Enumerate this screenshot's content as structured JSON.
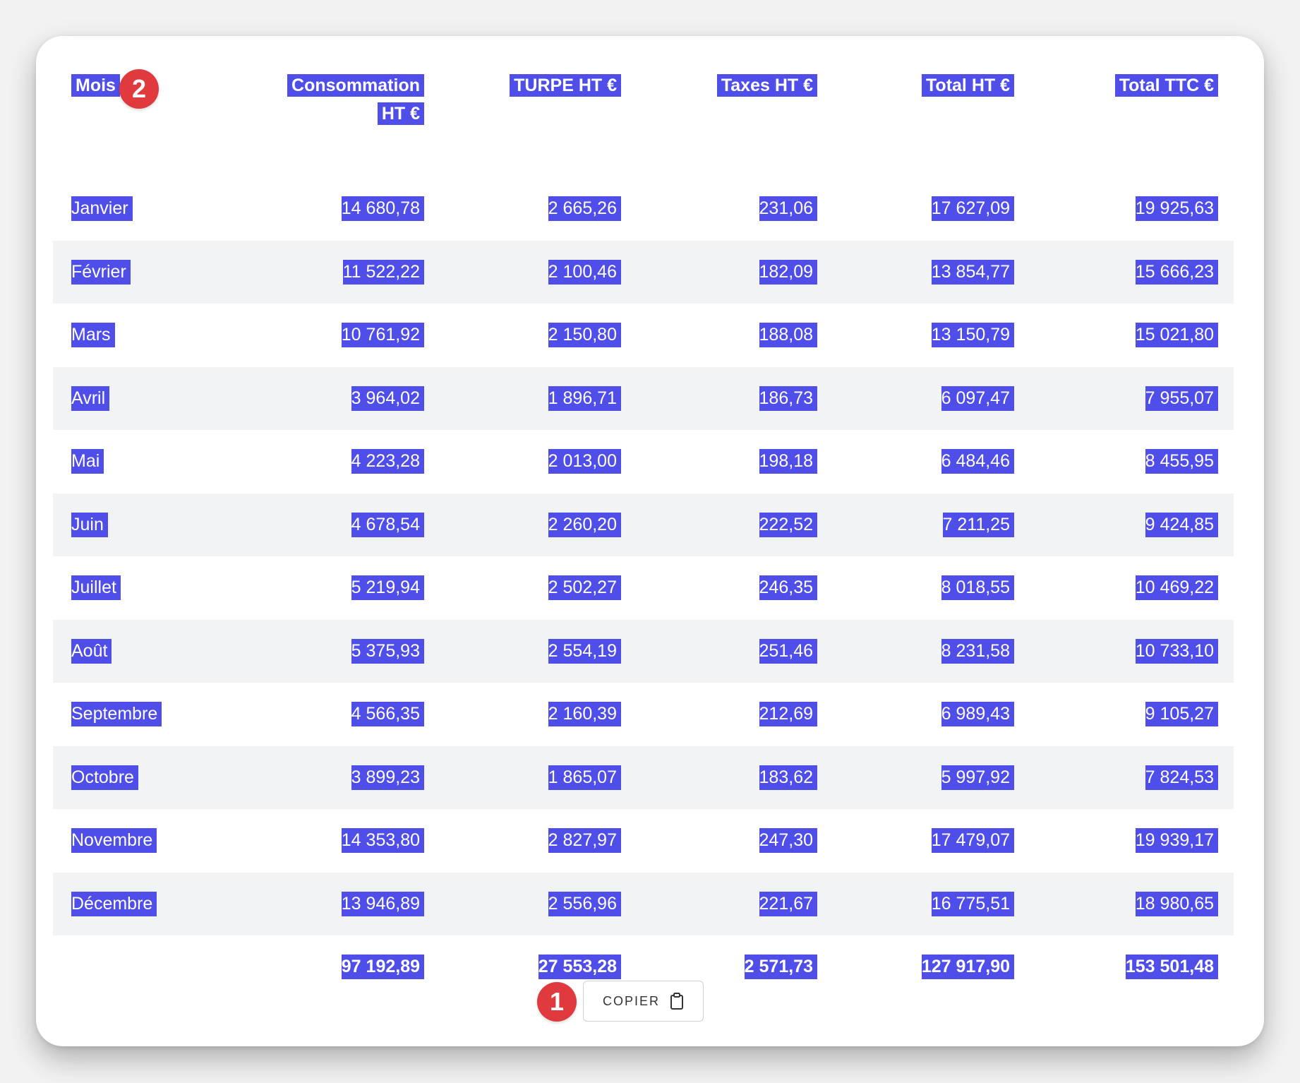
{
  "table": {
    "headers": {
      "mois": "Mois",
      "consommation_line1": "Consommation",
      "consommation_line2": "HT €",
      "turpe": "TURPE HT €",
      "taxes": "Taxes HT €",
      "total_ht": "Total HT €",
      "total_ttc": "Total TTC €"
    },
    "rows": [
      {
        "mois": "Janvier",
        "consommation": "14 680,78",
        "turpe": "2 665,26",
        "taxes": "231,06",
        "total_ht": "17 627,09",
        "total_ttc": "19 925,63"
      },
      {
        "mois": "Février",
        "consommation": "11 522,22",
        "turpe": "2 100,46",
        "taxes": "182,09",
        "total_ht": "13 854,77",
        "total_ttc": "15 666,23"
      },
      {
        "mois": "Mars",
        "consommation": "10 761,92",
        "turpe": "2 150,80",
        "taxes": "188,08",
        "total_ht": "13 150,79",
        "total_ttc": "15 021,80"
      },
      {
        "mois": "Avril",
        "consommation": "3 964,02",
        "turpe": "1 896,71",
        "taxes": "186,73",
        "total_ht": "6 097,47",
        "total_ttc": "7 955,07"
      },
      {
        "mois": "Mai",
        "consommation": "4 223,28",
        "turpe": "2 013,00",
        "taxes": "198,18",
        "total_ht": "6 484,46",
        "total_ttc": "8 455,95"
      },
      {
        "mois": "Juin",
        "consommation": "4 678,54",
        "turpe": "2 260,20",
        "taxes": "222,52",
        "total_ht": "7 211,25",
        "total_ttc": "9 424,85"
      },
      {
        "mois": "Juillet",
        "consommation": "5 219,94",
        "turpe": "2 502,27",
        "taxes": "246,35",
        "total_ht": "8 018,55",
        "total_ttc": "10 469,22"
      },
      {
        "mois": "Août",
        "consommation": "5 375,93",
        "turpe": "2 554,19",
        "taxes": "251,46",
        "total_ht": "8 231,58",
        "total_ttc": "10 733,10"
      },
      {
        "mois": "Septembre",
        "consommation": "4 566,35",
        "turpe": "2 160,39",
        "taxes": "212,69",
        "total_ht": "6 989,43",
        "total_ttc": "9 105,27"
      },
      {
        "mois": "Octobre",
        "consommation": "3 899,23",
        "turpe": "1 865,07",
        "taxes": "183,62",
        "total_ht": "5 997,92",
        "total_ttc": "7 824,53"
      },
      {
        "mois": "Novembre",
        "consommation": "14 353,80",
        "turpe": "2 827,97",
        "taxes": "247,30",
        "total_ht": "17 479,07",
        "total_ttc": "19 939,17"
      },
      {
        "mois": "Décembre",
        "consommation": "13 946,89",
        "turpe": "2 556,96",
        "taxes": "221,67",
        "total_ht": "16 775,51",
        "total_ttc": "18 980,65"
      }
    ],
    "totals": {
      "consommation": "97 192,89",
      "turpe": "27 553,28",
      "taxes": "2 571,73",
      "total_ht": "127 917,90",
      "total_ttc": "153 501,48"
    }
  },
  "badges": {
    "header_step": "2",
    "copy_step": "1"
  },
  "copy_button": {
    "label": "COPIER",
    "icon": "clipboard-icon"
  },
  "colors": {
    "selection_highlight": "#4f4ee8",
    "badge": "#e03a3f",
    "stripe": "#f2f3f5"
  }
}
